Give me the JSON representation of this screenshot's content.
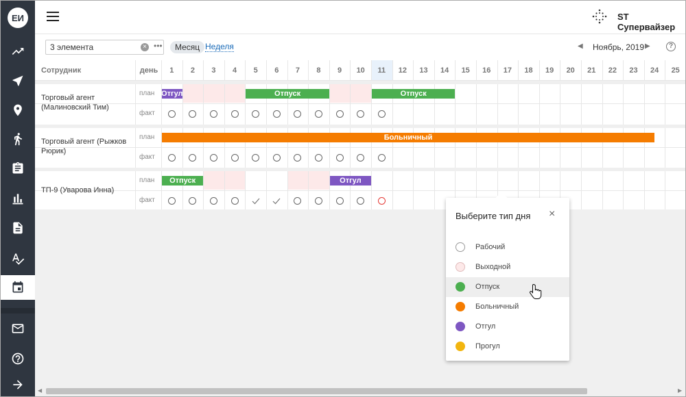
{
  "sidebar": {
    "avatar": "ЕИ",
    "icons": [
      "trend-icon",
      "send-icon",
      "location-icon",
      "walking-icon",
      "clipboard-icon",
      "bar-chart-icon",
      "document-icon",
      "spellcheck-icon",
      "calendar-icon",
      "mail-icon",
      "help-icon",
      "arrow-right-icon"
    ],
    "active": "calendar-icon"
  },
  "header": {
    "user": "ST Супервайзер"
  },
  "toolbar": {
    "search_value": "3 элемента",
    "month": "Месяц",
    "week": "Неделя",
    "period": "Ноябрь, 2019",
    "help": "?"
  },
  "table": {
    "col_employee": "Сотрудник",
    "col_day": "день",
    "days": [
      "1",
      "2",
      "3",
      "4",
      "5",
      "6",
      "7",
      "8",
      "9",
      "10",
      "11",
      "12",
      "13",
      "14",
      "15",
      "16",
      "17",
      "18",
      "19",
      "20",
      "21",
      "22",
      "23",
      "24",
      "25"
    ],
    "today": "11",
    "plan_label": "план",
    "fact_label": "факт",
    "rows": [
      {
        "employee": "Торговый агент (Малиновский Тим)",
        "weekends": [
          2,
          3,
          4,
          9,
          10
        ],
        "bars": [
          {
            "label": "Отгул",
            "start": 1,
            "end": 1,
            "color": "#7e57c2"
          },
          {
            "label": "Отпуск",
            "start": 5,
            "end": 8,
            "color": "#4caf50"
          },
          {
            "label": "Отпуск",
            "start": 11,
            "end": 14,
            "color": "#4caf50"
          }
        ],
        "fact": [
          "o",
          "o",
          "o",
          "o",
          "o",
          "o",
          "o",
          "o",
          "o",
          "o",
          "o"
        ]
      },
      {
        "employee": "Торговый агент (Рыжков Рюрик)",
        "weekends": [],
        "bars": [
          {
            "label": "Больничный",
            "start": 1,
            "end": 24.5,
            "color": "#f57c00"
          }
        ],
        "fact": [
          "o",
          "o",
          "o",
          "o",
          "o",
          "o",
          "o",
          "o",
          "o",
          "o",
          "o"
        ]
      },
      {
        "employee": "ТП-9 (Уварова Инна)",
        "weekends": [
          3,
          4,
          7,
          8
        ],
        "bars": [
          {
            "label": "Отпуск",
            "start": 1,
            "end": 2,
            "color": "#4caf50"
          },
          {
            "label": "Отгул",
            "start": 9,
            "end": 10,
            "color": "#7e57c2"
          }
        ],
        "fact": [
          "o",
          "o",
          "o",
          "o",
          "v",
          "v",
          "o",
          "o",
          "o",
          "o",
          "r"
        ]
      }
    ]
  },
  "popup": {
    "title": "Выберите тип дня",
    "close": "×",
    "hovered": "Отпуск",
    "items": [
      {
        "label": "Рабочий",
        "color": "#ffffff"
      },
      {
        "label": "Выходной",
        "color": "#fde9e9"
      },
      {
        "label": "Отпуск",
        "color": "#4caf50"
      },
      {
        "label": "Больничный",
        "color": "#f57c00"
      },
      {
        "label": "Отгул",
        "color": "#7e57c2"
      },
      {
        "label": "Прогул",
        "color": "#f2b50f"
      }
    ]
  }
}
